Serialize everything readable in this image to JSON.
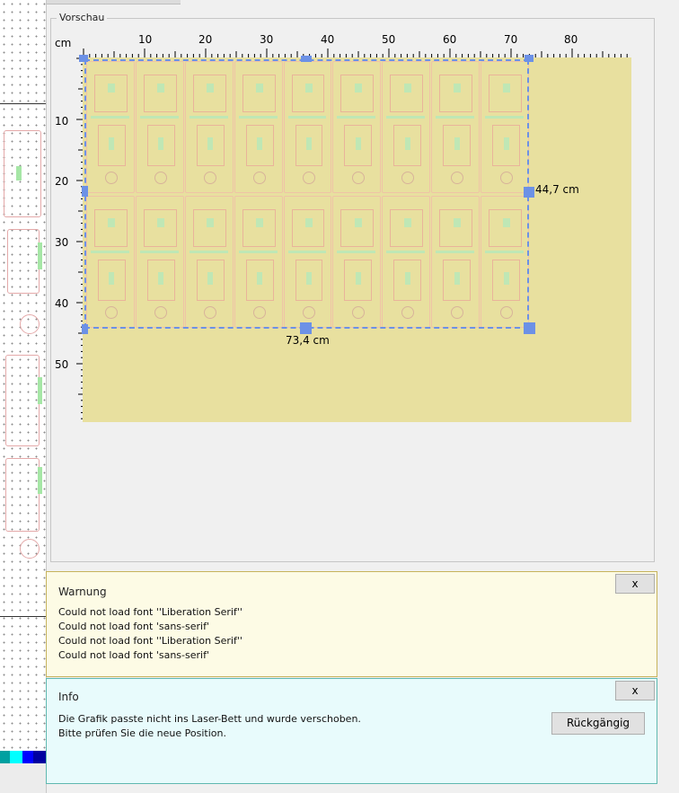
{
  "preview": {
    "legend": "Vorschau",
    "unit": "cm",
    "x_ticks": [
      "10",
      "20",
      "30",
      "40",
      "50",
      "60",
      "70",
      "80"
    ],
    "y_ticks": [
      "10",
      "20",
      "30",
      "40",
      "50"
    ],
    "width_label": "73,4 cm",
    "height_label": "44,7 cm",
    "colors": {
      "bed": "#e8e09f",
      "selection": "#6c91e6",
      "cut_lines": "#e9a98a",
      "engrave": "#a6e6a6"
    }
  },
  "warning": {
    "title": "Warnung",
    "close_label": "x",
    "lines": [
      "Could not load font ''Liberation Serif''",
      "Could not load font 'sans-serif'",
      "Could not load font ''Liberation Serif''",
      "Could not load font 'sans-serif'"
    ]
  },
  "info": {
    "title": "Info",
    "close_label": "x",
    "lines": [
      "Die Grafik passte nicht ins Laser-Bett und wurde verschoben.",
      "Bitte prüfen Sie die neue Position."
    ],
    "undo_label": "Rückgängig"
  }
}
